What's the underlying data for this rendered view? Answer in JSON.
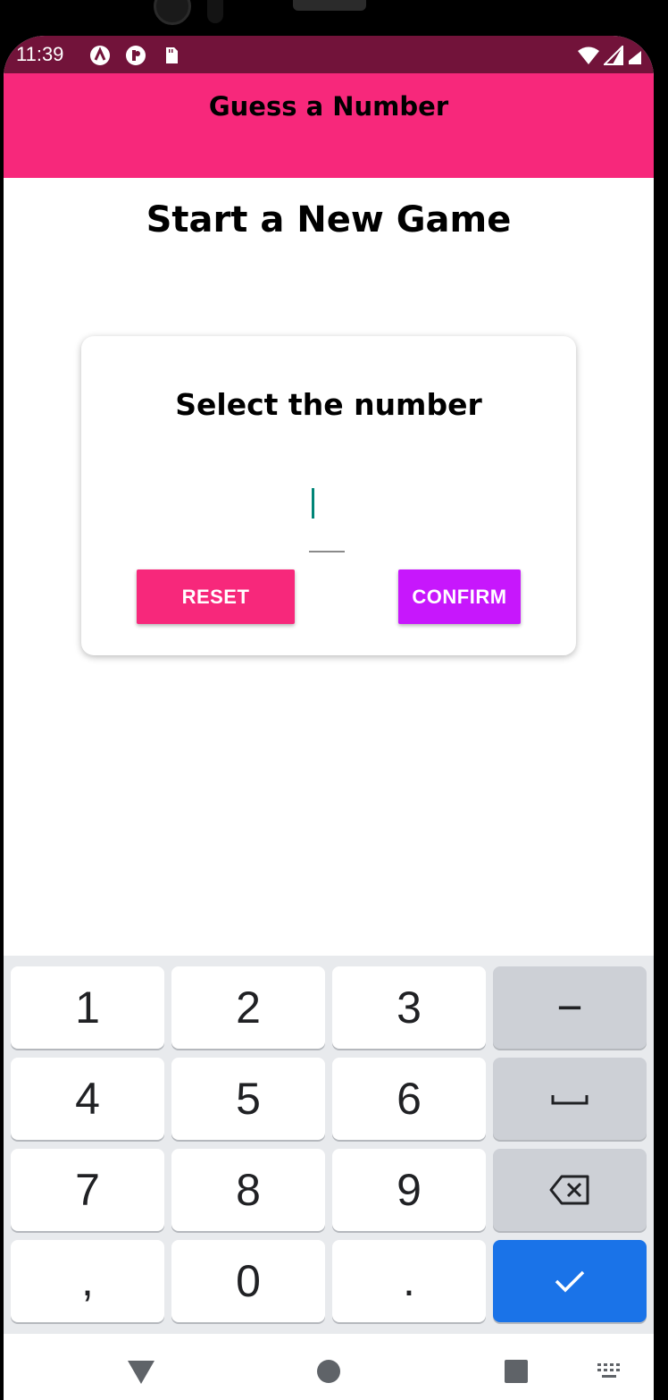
{
  "status_bar": {
    "time": "11:39",
    "icons_left": [
      "a-app-icon",
      "p-app-icon",
      "sd-card-icon"
    ],
    "icons_right": [
      "wifi-icon",
      "signal-icon",
      "battery-icon"
    ],
    "color": "#72133a"
  },
  "header": {
    "title": "Guess a Number",
    "color": "#f7287b"
  },
  "screen": {
    "title": "Start a New Game"
  },
  "card": {
    "title": "Select the number",
    "input": {
      "value": "",
      "placeholder": ""
    },
    "reset_label": "RESET",
    "confirm_label": "CONFIRM",
    "reset_color": "#f7287b",
    "confirm_color": "#c717fc"
  },
  "keyboard": {
    "rows": [
      [
        "1",
        "2",
        "3",
        "−"
      ],
      [
        "4",
        "5",
        "6",
        "space"
      ],
      [
        "7",
        "8",
        "9",
        "backspace"
      ],
      [
        ",",
        "0",
        ".",
        "done"
      ]
    ],
    "keys": {
      "k1": "1",
      "k2": "2",
      "k3": "3",
      "minus": "−",
      "k4": "4",
      "k5": "5",
      "k6": "6",
      "k7": "7",
      "k8": "8",
      "k9": "9",
      "comma": ",",
      "k0": "0",
      "period": "."
    },
    "enter_color": "#1a73e8"
  },
  "nav_bar": {
    "icons": [
      "back-icon",
      "home-icon",
      "recents-icon",
      "keyboard-switch-icon"
    ]
  }
}
